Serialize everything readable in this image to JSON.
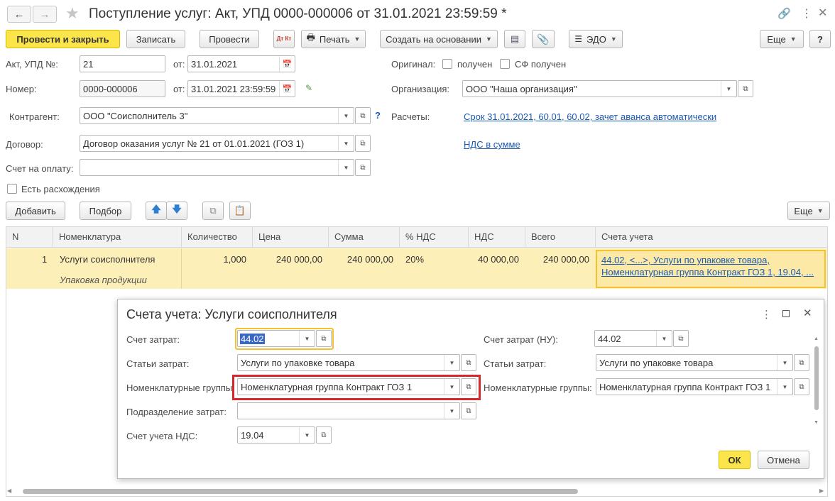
{
  "window": {
    "title": "Поступление услуг: Акт, УПД 0000-000006 от 31.01.2021 23:59:59 *"
  },
  "toolbar": {
    "post_close": "Провести и закрыть",
    "save": "Записать",
    "post": "Провести",
    "dtkt": "Дт Кт",
    "print": "Печать",
    "create_based": "Создать на основании",
    "edo": "ЭДО",
    "more": "Еще",
    "help": "?"
  },
  "header": {
    "act_label": "Акт, УПД №:",
    "act_value": "21",
    "from_label": "от:",
    "act_date": "31.01.2021",
    "number_label": "Номер:",
    "number_value": "0000-000006",
    "from_label2": "от:",
    "number_date": "31.01.2021 23:59:59",
    "original_label": "Оригинал:",
    "received_label": "получен",
    "sf_received_label": "СФ получен",
    "org_label": "Организация:",
    "org_value": "ООО \"Наша организация\"",
    "contractor_label": "Контрагент:",
    "contractor_value": "ООО \"Соисполнитель 3\"",
    "q": "?",
    "settlements_label": "Расчеты:",
    "settlements_link": "Срок 31.01.2021, 60.01, 60.02, зачет аванса автоматически",
    "contract_label": "Договор:",
    "contract_value": "Договор оказания услуг № 21 от 01.01.2021 (ГОЗ 1)",
    "vat_link": "НДС в сумме",
    "invoice_label": "Счет на оплату:",
    "invoice_value": "",
    "discrepancy_label": "Есть расхождения"
  },
  "table_toolbar": {
    "add": "Добавить",
    "pick": "Подбор",
    "more": "Еще"
  },
  "table": {
    "columns": [
      "N",
      "Номенклатура",
      "Количество",
      "Цена",
      "Сумма",
      "% НДС",
      "НДС",
      "Всего",
      "Счета учета"
    ],
    "rows": [
      {
        "n": "1",
        "item": "Услуги соисполнителя",
        "item_sub": "Упаковка продукции",
        "qty": "1,000",
        "price": "240 000,00",
        "sum": "240 000,00",
        "vat_rate": "20%",
        "vat": "40 000,00",
        "total": "240 000,00",
        "accounts_line1": "44.02, <...>, Услуги по упаковке товара,",
        "accounts_line2": "Номенклатурная группа Контракт ГОЗ 1, 19.04, ..."
      }
    ]
  },
  "dialog": {
    "title": "Счета учета: Услуги соисполнителя",
    "cost_account_label": "Счет затрат:",
    "cost_account_value": "44.02",
    "cost_items_label": "Статьи затрат:",
    "cost_items_value": "Услуги по упаковке товара",
    "nom_groups_label": "Номенклатурные группы:",
    "nom_groups_value": "Номенклатурная группа Контракт ГОЗ 1",
    "division_label": "Подразделение затрат:",
    "division_value": "",
    "vat_account_label": "Счет учета НДС:",
    "vat_account_value": "19.04",
    "cost_account_nu_label": "Счет затрат (НУ):",
    "cost_account_nu_value": "44.02",
    "cost_items_nu_label": "Статьи затрат:",
    "cost_items_nu_value": "Услуги по упаковке товара",
    "nom_groups_nu_label": "Номенклатурные группы:",
    "nom_groups_nu_value": "Номенклатурная группа Контракт ГОЗ 1",
    "ok": "ОК",
    "cancel": "Отмена"
  },
  "colors": {
    "accent_yellow": "#fbe54a",
    "link_blue": "#1a5ab5",
    "highlight_red": "#d9262b",
    "selected_row": "#fcefb8"
  }
}
